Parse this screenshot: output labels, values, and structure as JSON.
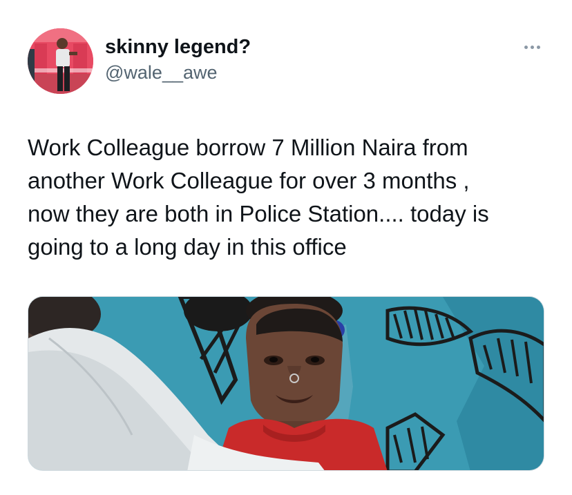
{
  "tweet": {
    "display_name": "skinny legend?",
    "handle": "@wale__awe",
    "text": "Work Colleague borrow 7 Million Naira from\nanother Work Colleague for over 3 months ,\nnow they are both in Police Station.... today is\ngoing to a long day in this office",
    "avatar_icon": "profile-photo",
    "more_icon": "more-horizontal-icon",
    "media_description_icon": "attached-photo"
  },
  "colors": {
    "text_primary": "#0f1419",
    "text_secondary": "#536471",
    "avatar_bg": "#e84a63",
    "media_wall": "#3b9bb3",
    "border": "#cfd9de"
  }
}
